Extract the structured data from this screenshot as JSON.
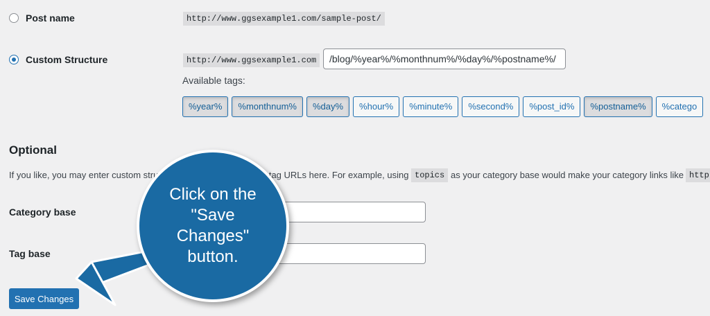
{
  "permalink_options": [
    {
      "label": "Post name",
      "example": "http://www.ggsexample1.com/sample-post/",
      "checked": false
    },
    {
      "label": "Custom Structure",
      "prefix": "http://www.ggsexample1.com",
      "value": "/blog/%year%/%monthnum%/%day%/%postname%/",
      "checked": true
    }
  ],
  "available_tags_label": "Available tags:",
  "tags": [
    "%year%",
    "%monthnum%",
    "%day%",
    "%hour%",
    "%minute%",
    "%second%",
    "%post_id%",
    "%postname%",
    "%catego"
  ],
  "optional": {
    "title": "Optional",
    "desc_part1": "If you like, you may enter custom stru",
    "desc_part2": "d tag URLs here. For example, using",
    "code": "topics",
    "desc_part3": "as your category base would make your category links like",
    "code_url": "http"
  },
  "fields": {
    "category_base_label": "Category base",
    "tag_base_label": "Tag base"
  },
  "save_button": "Save Changes",
  "callout": {
    "line1": "Click on the",
    "line2": "\"Save Changes\"",
    "line3": "button."
  },
  "colors": {
    "primary": "#2271b1",
    "callout": "#1a6aa3",
    "background": "#f0f0f1"
  }
}
